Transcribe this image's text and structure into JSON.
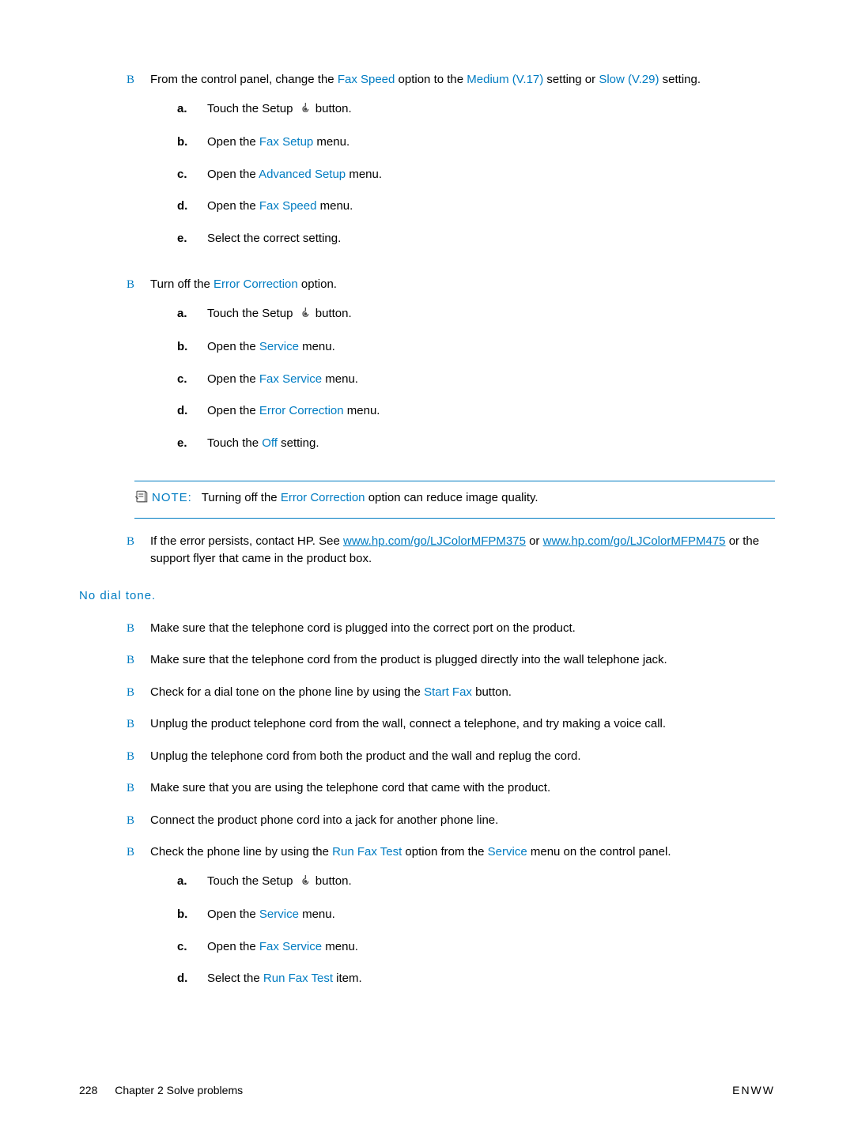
{
  "bullets_top": [
    {
      "parts": [
        {
          "t": "From the control panel, change the "
        },
        {
          "t": "Fax Speed",
          "cls": "link"
        },
        {
          "t": " option to the "
        },
        {
          "t": "Medium (V.17)",
          "cls": "link"
        },
        {
          "t": " setting or "
        },
        {
          "t": "Slow (V.29)",
          "cls": "link"
        },
        {
          "t": " setting."
        }
      ],
      "subs": [
        {
          "m": "a.",
          "parts": [
            {
              "t": "Touch the Setup "
            },
            {
              "icon": true
            },
            {
              "t": " button."
            }
          ]
        },
        {
          "m": "b.",
          "parts": [
            {
              "t": "Open the "
            },
            {
              "t": "Fax Setup",
              "cls": "link"
            },
            {
              "t": " menu."
            }
          ]
        },
        {
          "m": "c.",
          "parts": [
            {
              "t": "Open the "
            },
            {
              "t": "Advanced Setup",
              "cls": "link"
            },
            {
              "t": " menu."
            }
          ]
        },
        {
          "m": "d.",
          "parts": [
            {
              "t": "Open the "
            },
            {
              "t": "Fax Speed",
              "cls": "link"
            },
            {
              "t": " menu."
            }
          ]
        },
        {
          "m": "e.",
          "parts": [
            {
              "t": "Select the correct setting."
            }
          ]
        }
      ]
    },
    {
      "parts": [
        {
          "t": "Turn off the "
        },
        {
          "t": "Error Correction",
          "cls": "link"
        },
        {
          "t": " option."
        }
      ],
      "subs": [
        {
          "m": "a.",
          "parts": [
            {
              "t": "Touch the Setup "
            },
            {
              "icon": true
            },
            {
              "t": " button."
            }
          ]
        },
        {
          "m": "b.",
          "parts": [
            {
              "t": "Open the "
            },
            {
              "t": "Service",
              "cls": "link"
            },
            {
              "t": " menu."
            }
          ]
        },
        {
          "m": "c.",
          "parts": [
            {
              "t": "Open the "
            },
            {
              "t": "Fax Service",
              "cls": "link"
            },
            {
              "t": " menu."
            }
          ]
        },
        {
          "m": "d.",
          "parts": [
            {
              "t": "Open the "
            },
            {
              "t": "Error Correction",
              "cls": "link"
            },
            {
              "t": " menu."
            }
          ]
        },
        {
          "m": "e.",
          "parts": [
            {
              "t": "Touch the "
            },
            {
              "t": "Off",
              "cls": "link"
            },
            {
              "t": " setting."
            }
          ]
        }
      ]
    }
  ],
  "note": {
    "label": "NOTE:",
    "parts": [
      {
        "t": "Turning off the "
      },
      {
        "t": "Error Correction",
        "cls": "link"
      },
      {
        "t": " option can reduce image quality."
      }
    ]
  },
  "bullet_contact": {
    "parts": [
      {
        "t": "If the error persists, contact HP. See "
      },
      {
        "t": "www.hp.com/go/LJColorMFPM375",
        "cls": "ulink"
      },
      {
        "t": " or "
      },
      {
        "t": "www.hp.com/go/LJColorMFPM475",
        "cls": "ulink"
      },
      {
        "t": " or the support flyer that came in the product box."
      }
    ]
  },
  "heading": "No dial tone.",
  "bullets_bottom": [
    {
      "parts": [
        {
          "t": "Make sure that the telephone cord is plugged into the correct port on the product."
        }
      ]
    },
    {
      "parts": [
        {
          "t": "Make sure that the telephone cord from the product is plugged directly into the wall telephone jack."
        }
      ]
    },
    {
      "parts": [
        {
          "t": "Check for a dial tone on the phone line by using the "
        },
        {
          "t": "Start Fax",
          "cls": "link"
        },
        {
          "t": " button."
        }
      ]
    },
    {
      "parts": [
        {
          "t": "Unplug the product telephone cord from the wall, connect a telephone, and try making a voice call."
        }
      ]
    },
    {
      "parts": [
        {
          "t": "Unplug the telephone cord from both the product and the wall and replug the cord."
        }
      ]
    },
    {
      "parts": [
        {
          "t": "Make sure that you are using the telephone cord that came with the product."
        }
      ]
    },
    {
      "parts": [
        {
          "t": "Connect the product phone cord into a jack for another phone line."
        }
      ]
    },
    {
      "parts": [
        {
          "t": "Check the phone line by using the "
        },
        {
          "t": "Run Fax Test",
          "cls": "link"
        },
        {
          "t": " option from the "
        },
        {
          "t": "Service",
          "cls": "link"
        },
        {
          "t": " menu on the control panel."
        }
      ],
      "subs": [
        {
          "m": "a.",
          "parts": [
            {
              "t": "Touch the Setup "
            },
            {
              "icon": true
            },
            {
              "t": " button."
            }
          ]
        },
        {
          "m": "b.",
          "parts": [
            {
              "t": "Open the "
            },
            {
              "t": "Service",
              "cls": "link"
            },
            {
              "t": " menu."
            }
          ]
        },
        {
          "m": "c.",
          "parts": [
            {
              "t": "Open the "
            },
            {
              "t": "Fax Service",
              "cls": "link"
            },
            {
              "t": " menu."
            }
          ]
        },
        {
          "m": "d.",
          "parts": [
            {
              "t": "Select the "
            },
            {
              "t": "Run Fax Test",
              "cls": "link"
            },
            {
              "t": " item."
            }
          ]
        }
      ]
    }
  ],
  "footer": {
    "page": "228",
    "chapter": "Chapter 2   Solve problems",
    "right": "ENWW"
  },
  "bullet_glyph": "B"
}
